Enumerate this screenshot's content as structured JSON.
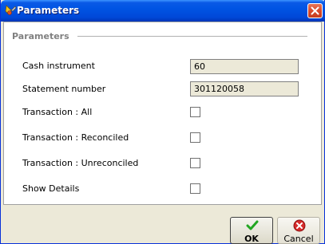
{
  "window": {
    "title": "Parameters",
    "icon": "app-icon",
    "close_icon": "close-icon"
  },
  "group": {
    "title": "Parameters"
  },
  "fields": [
    {
      "label": "Cash instrument",
      "value": "60"
    },
    {
      "label": "Statement number",
      "value": "301120058"
    }
  ],
  "checkboxes": [
    {
      "label": "Transaction : All",
      "checked": false
    },
    {
      "label": "Transaction : Reconciled",
      "checked": false
    },
    {
      "label": "Transaction : Unreconciled",
      "checked": false
    },
    {
      "label": "Show Details",
      "checked": false
    }
  ],
  "buttons": {
    "ok": {
      "label": "OK",
      "icon": "checkmark-icon"
    },
    "cancel": {
      "label": "Cancel",
      "icon": "cancel-icon"
    }
  },
  "colors": {
    "titlebar": "#0054e3",
    "dialog_bg": "#ece9d8",
    "ok_icon": "#22a622",
    "cancel_icon": "#d62a2a"
  }
}
